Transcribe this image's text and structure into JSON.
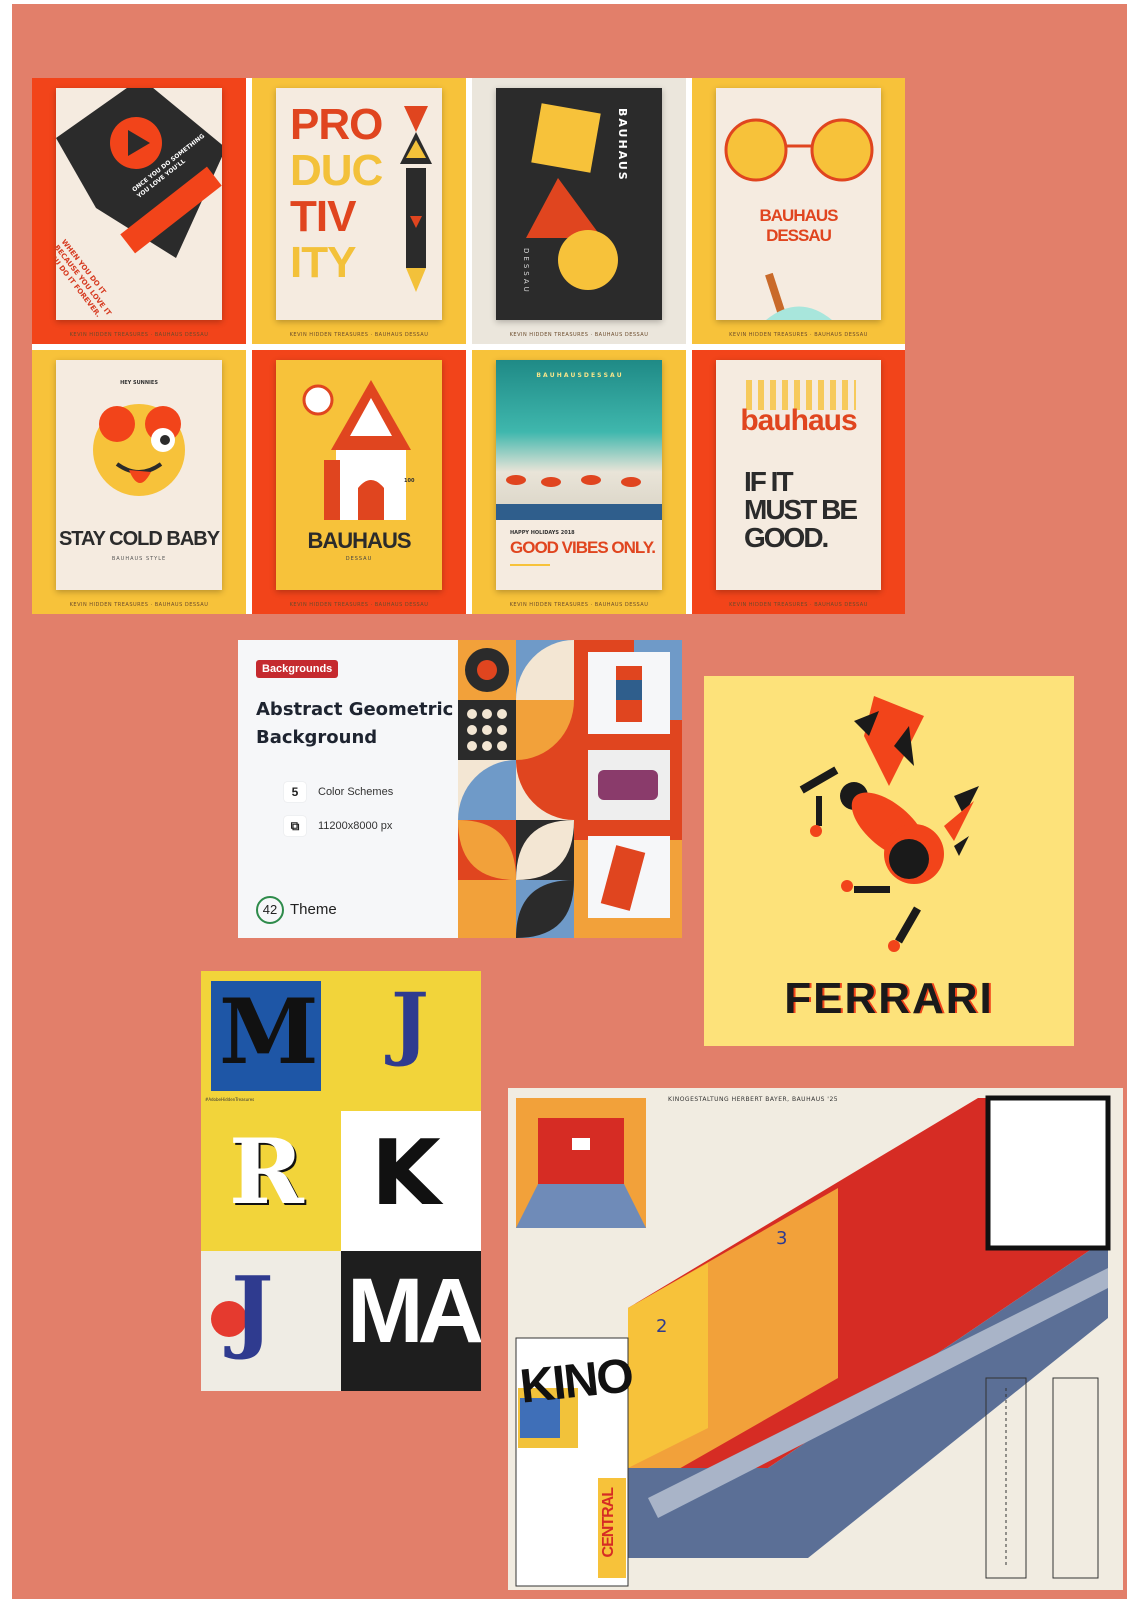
{
  "colors": {
    "board": "#e27f6a",
    "orange_red": "#f2441a",
    "yellow": "#f7c23a",
    "cream": "#f5ebe0",
    "dark": "#2b2b2b",
    "card_tag": "#c52a2f"
  },
  "posters": [
    {
      "id": "play",
      "lines": [
        "ONCE YOU DO SOMETHING",
        "YOU LOVE YOU'LL",
        "WHEN YOU DO IT",
        "BECAUSE YOU LOVE IT",
        "YOU DO IT FOREVER."
      ],
      "caption": "KEVIN HIDDEN TREASURES · BAUHAUS DESSAU"
    },
    {
      "id": "productivity",
      "lines": [
        "PRO",
        "DUC",
        "TIV",
        "ITY"
      ],
      "caption": "KEVIN HIDDEN TREASURES · BAUHAUS DESSAU"
    },
    {
      "id": "dessau-shapes",
      "vertical_text": "BAUHAUS",
      "side_text": "DESSAU",
      "caption": "KEVIN HIDDEN TREASURES · BAUHAUS DESSAU"
    },
    {
      "id": "glasses",
      "lines": [
        "BAUHAUS",
        "DESSAU"
      ],
      "caption": "KEVIN HIDDEN TREASURES · BAUHAUS DESSAU"
    },
    {
      "id": "stay-cold",
      "top": "HEY SUNNIES",
      "title": "STAY COLD BABY",
      "sub": "BAUHAUS STYLE",
      "caption": "KEVIN HIDDEN TREASURES · BAUHAUS DESSAU"
    },
    {
      "id": "house",
      "badge": "100",
      "title": "BAUHAUS",
      "sub": "DESSAU",
      "caption": "KEVIN HIDDEN TREASURES · BAUHAUS DESSAU"
    },
    {
      "id": "beach",
      "top": "B A U H A U S   D E S S A U",
      "small": "HAPPY HOLIDAYS 2018",
      "title": "GOOD VIBES ONLY.",
      "caption": "KEVIN HIDDEN TREASURES · BAUHAUS DESSAU"
    },
    {
      "id": "bauhaus-good",
      "title": "bauhaus",
      "lines": [
        "IF IT",
        "MUST BE",
        "GOOD."
      ],
      "caption": "KEVIN HIDDEN TREASURES · BAUHAUS DESSAU"
    }
  ],
  "card": {
    "tag": "Backgrounds",
    "title": "Abstract Geometric Background",
    "specs": [
      {
        "badge": "5",
        "label": "Color Schemes"
      },
      {
        "badge": "",
        "label": "11200x8000 px"
      }
    ],
    "theme_number": "42",
    "theme_label": "Theme"
  },
  "ferrari": {
    "word": "FERRARI"
  },
  "letters": {
    "glyphs": [
      "M",
      "J",
      "R",
      "K",
      "J",
      "MA"
    ],
    "credit": "#AdobeHiddenTreasures"
  },
  "kino": {
    "header": "KINOGESTALTUNG   HERBERT BAYER, BAUHAUS '25",
    "sign": "KINO",
    "sign2": "CENTRAL",
    "nums": [
      "2",
      "3"
    ]
  }
}
